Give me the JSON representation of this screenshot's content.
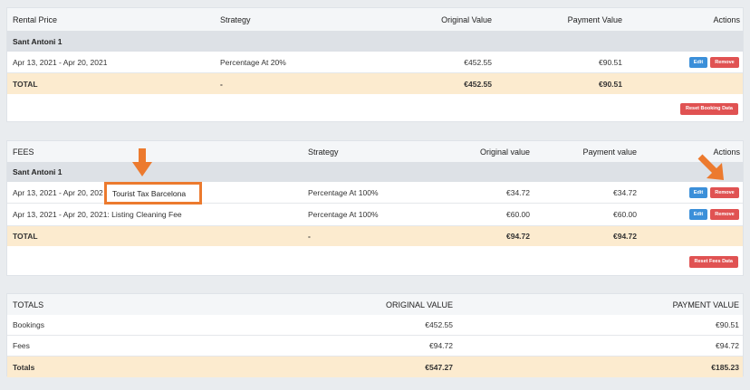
{
  "rental": {
    "headers": {
      "c1": "Rental Price",
      "c2": "Strategy",
      "c3": "Original Value",
      "c4": "Payment Value",
      "c5": "Actions"
    },
    "group": "Sant Antoni 1",
    "row": {
      "dates": "Apr 13, 2021 - Apr 20, 2021",
      "strategy": "Percentage At 20%",
      "original": "€452.55",
      "payment": "€90.51"
    },
    "total": {
      "label": "TOTAL",
      "strategy": "-",
      "original": "€452.55",
      "payment": "€90.51"
    },
    "reset_label": "Reset Booking Data"
  },
  "fees": {
    "headers": {
      "c1": "FEES",
      "c2": "Strategy",
      "c3": "Original value",
      "c4": "Payment value",
      "c5": "Actions"
    },
    "group": "Sant Antoni 1",
    "rows": [
      {
        "dates": "Apr 13, 2021 - Apr 20, 202",
        "name": "Tourist Tax Barcelona",
        "strategy": "Percentage At 100%",
        "original": "€34.72",
        "payment": "€34.72"
      },
      {
        "dates": "Apr 13, 2021 - Apr 20, 2021: Listing Cleaning Fee",
        "strategy": "Percentage At 100%",
        "original": "€60.00",
        "payment": "€60.00"
      }
    ],
    "total": {
      "label": "TOTAL",
      "strategy": "-",
      "original": "€94.72",
      "payment": "€94.72"
    },
    "reset_label": "Reset Fees Data"
  },
  "totals": {
    "headers": {
      "c1": "TOTALS",
      "c2": "ORIGINAL VALUE",
      "c3": "PAYMENT VALUE"
    },
    "rows": [
      {
        "label": "Bookings",
        "original": "€452.55",
        "payment": "€90.51"
      },
      {
        "label": "Fees",
        "original": "€94.72",
        "payment": "€94.72"
      }
    ],
    "total": {
      "label": "Totals",
      "original": "€547.27",
      "payment": "€185.23"
    }
  },
  "buttons": {
    "edit": "Edit",
    "remove": "Remove"
  },
  "colors": {
    "accent_orange": "#ec7a2e",
    "edit_blue": "#3b8fd9",
    "remove_red": "#e05252",
    "total_bg": "#fcebcf",
    "group_bg": "#dde1e6"
  }
}
